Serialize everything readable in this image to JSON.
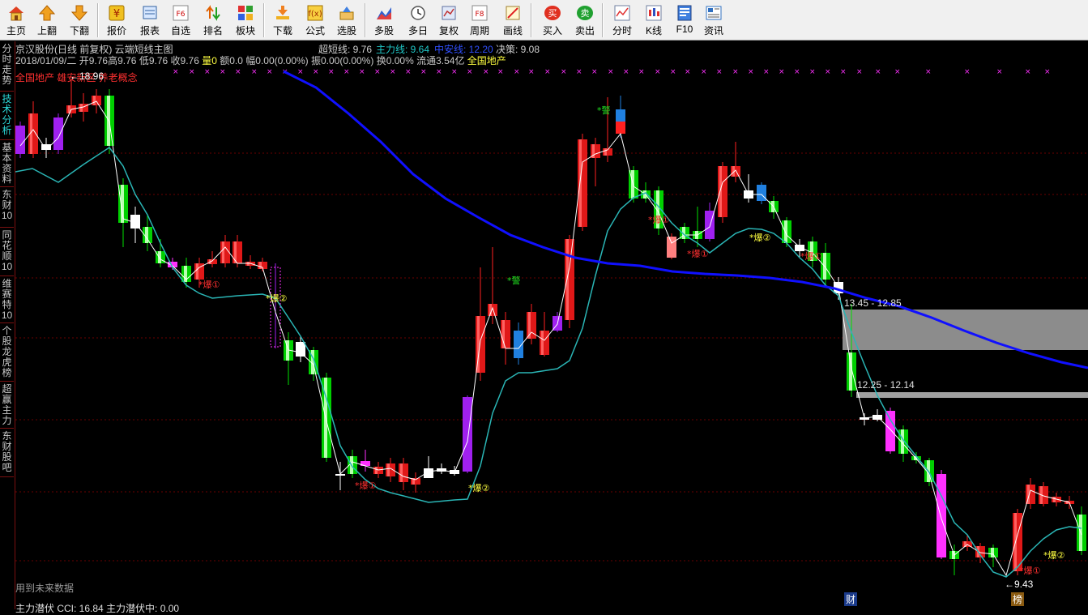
{
  "toolbar": {
    "buttons": [
      {
        "id": "home",
        "label": "主页",
        "icon": "home-icon"
      },
      {
        "id": "page-up",
        "label": "上翻",
        "icon": "arrow-up-icon"
      },
      {
        "id": "page-down",
        "label": "下翻",
        "icon": "arrow-down-icon"
      },
      {
        "id": "quote",
        "label": "报价",
        "icon": "yen-icon"
      },
      {
        "id": "report",
        "label": "报表",
        "icon": "report-icon"
      },
      {
        "id": "watchlist",
        "label": "自选",
        "icon": "f6-icon"
      },
      {
        "id": "rank",
        "label": "排名",
        "icon": "rank-icon"
      },
      {
        "id": "sector",
        "label": "板块",
        "icon": "sector-grid-icon"
      },
      {
        "id": "download",
        "label": "下载",
        "icon": "download-icon"
      },
      {
        "id": "formula",
        "label": "公式",
        "icon": "formula-icon"
      },
      {
        "id": "screener",
        "label": "选股",
        "icon": "screener-icon"
      },
      {
        "id": "multi-stock",
        "label": "多股",
        "icon": "multi-stock-icon"
      },
      {
        "id": "multi-day",
        "label": "多日",
        "icon": "clock-icon"
      },
      {
        "id": "adjust",
        "label": "复权",
        "icon": "adjust-icon"
      },
      {
        "id": "period",
        "label": "周期",
        "icon": "f8-icon"
      },
      {
        "id": "draw",
        "label": "画线",
        "icon": "draw-line-icon"
      },
      {
        "id": "buy",
        "label": "买入",
        "icon": "buy-icon",
        "glyph": "买"
      },
      {
        "id": "sell",
        "label": "卖出",
        "icon": "sell-icon",
        "glyph": "卖"
      },
      {
        "id": "intraday",
        "label": "分时",
        "icon": "intraday-chart-icon"
      },
      {
        "id": "kline",
        "label": "K线",
        "icon": "kline-icon"
      },
      {
        "id": "f10",
        "label": "F10",
        "icon": "f10-icon"
      },
      {
        "id": "news",
        "label": "资讯",
        "icon": "news-icon"
      }
    ]
  },
  "side_tabs": [
    {
      "label": "分时走势",
      "active": false
    },
    {
      "label": "技术分析",
      "active": true
    },
    {
      "label": "基本资料",
      "active": false
    },
    {
      "label": "东财10",
      "active": false
    },
    {
      "label": "同花顺10",
      "active": false
    },
    {
      "label": "维赛特10",
      "active": false
    },
    {
      "label": "个股龙虎榜",
      "active": false
    },
    {
      "label": "超赢主力",
      "active": false
    },
    {
      "label": "东财股吧",
      "active": false
    }
  ],
  "header": {
    "title": "京汉股份(日线 前复权) 云端短线主图",
    "indicators": {
      "chao_duan": "超短线: 9.76",
      "zhu_li": "主力线: 9.64",
      "zhong_an": "中安线: 12.20",
      "jue_ce": "决策: 9.08"
    },
    "quote_line": {
      "date": "2018/01/09/二",
      "open": "开9.76",
      "high": "高9.76",
      "low": "低9.76",
      "close": "收9.76",
      "volume": "量0",
      "amount": "额0.0",
      "change": "幅0.00(0.00%)",
      "amplitude": "振0.00(0.00%)",
      "turnover": "换0.00%",
      "float": "流通3.54亿",
      "concept1": "全国地产"
    },
    "concept_line": "全国地产 雄安新区 养老概念",
    "max_price": "18.96"
  },
  "chart_annotations": {
    "zone_upper": "13.45 - 12.85",
    "zone_lower": "12.25 - 12.14",
    "low_price": "9.43",
    "signals": [
      "*爆①",
      "*爆②",
      "*警"
    ]
  },
  "bottom": {
    "note": "用到未来数据",
    "markers": [
      "财",
      "榜"
    ],
    "indicator_line": "主力潜伏 CCI: 16.84  主力潜伏中: 0.00"
  },
  "colors": {
    "up": "#ff2020",
    "down": "#00e000",
    "purple": "#a020f0",
    "magenta": "#ff30ff",
    "blue_ma": "#1010ff",
    "teal": "#2ab5b5",
    "white": "#ffffff"
  }
}
